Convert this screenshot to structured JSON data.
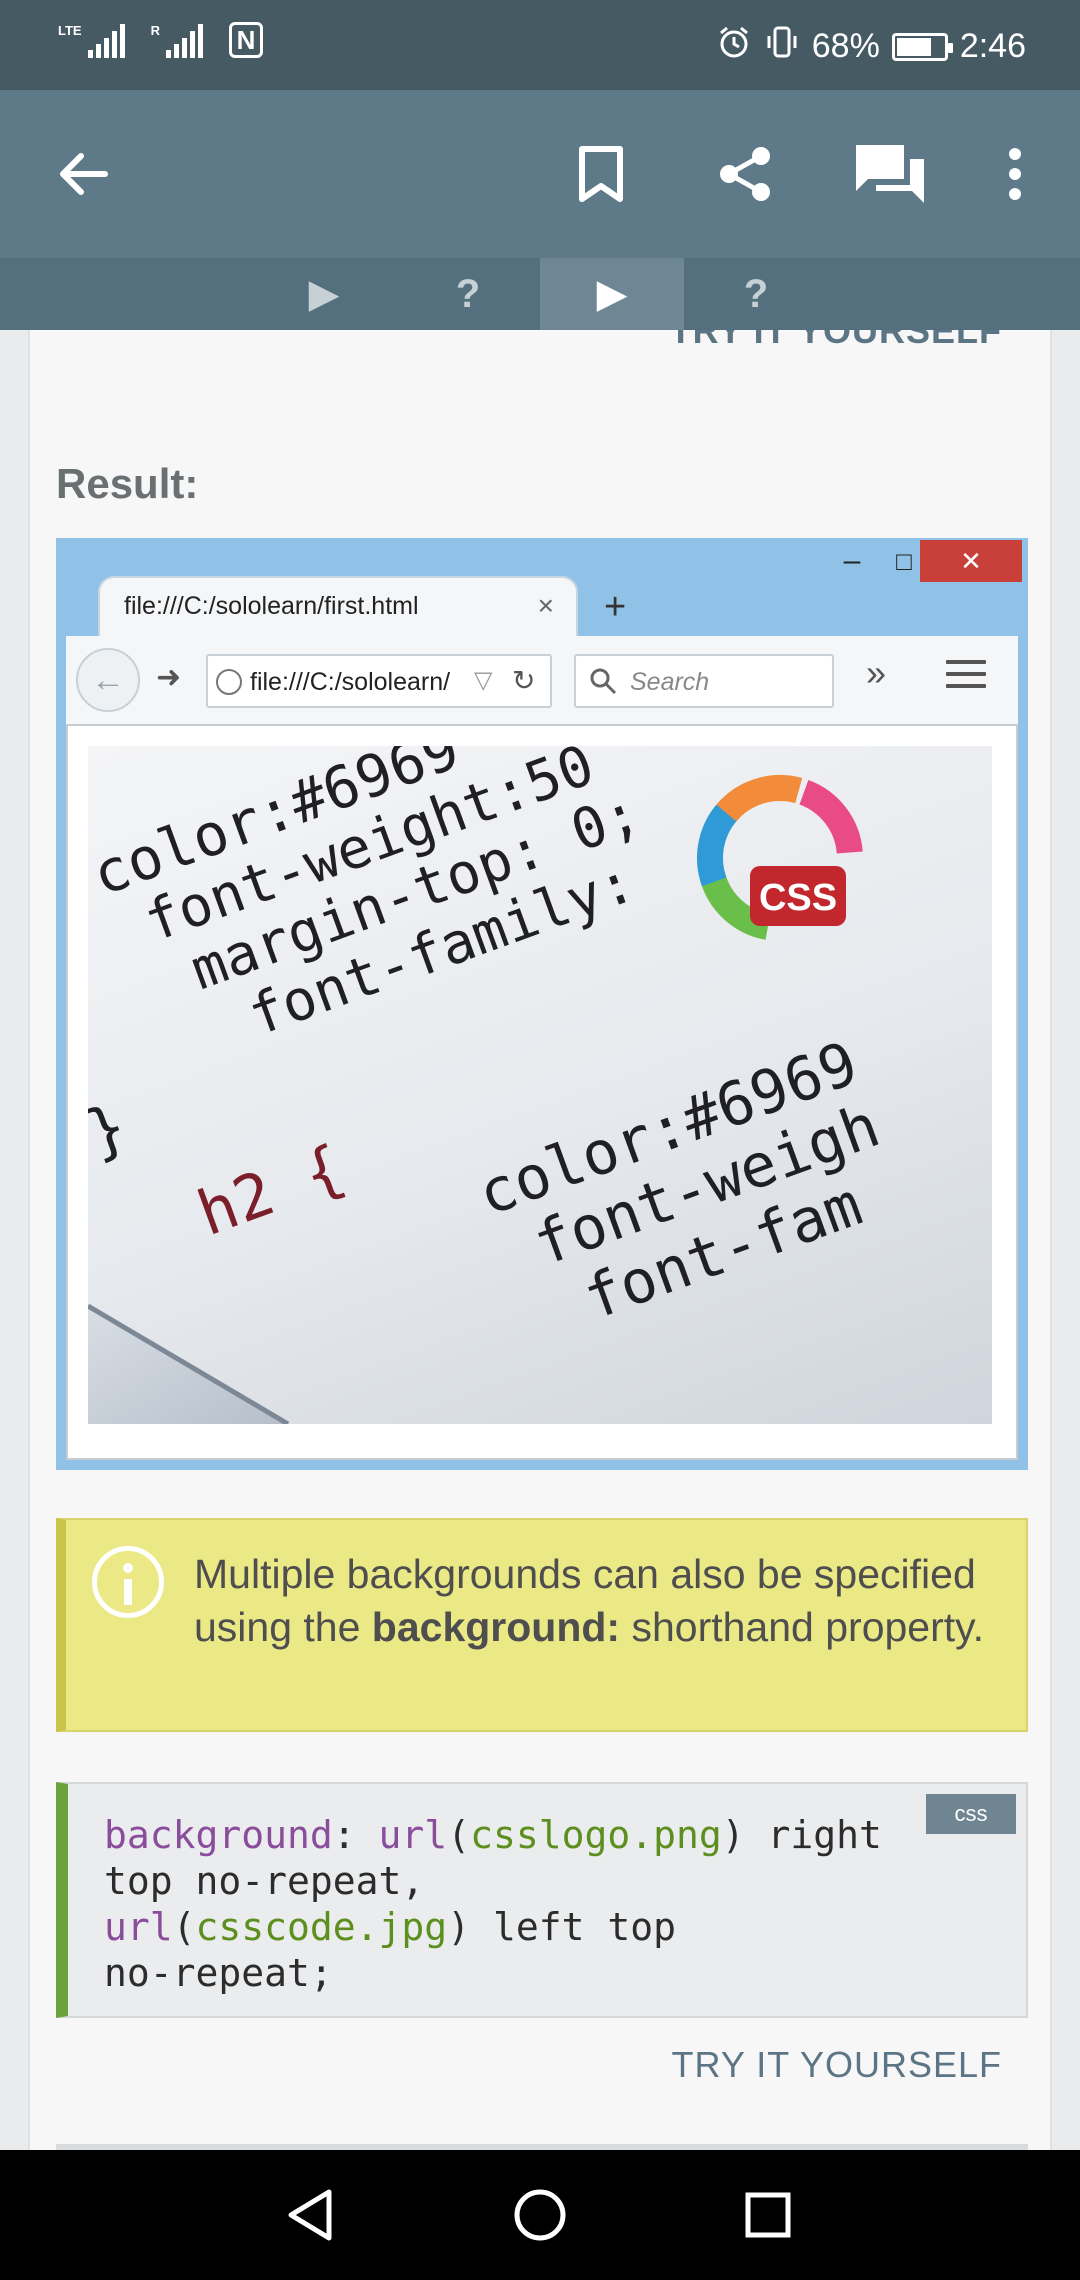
{
  "status_bar": {
    "network_left": "LTE",
    "network_right": "R",
    "battery": "68%",
    "time": "2:46"
  },
  "toolbar": {
    "icons": [
      "back-arrow-icon",
      "bookmark-icon",
      "share-icon",
      "comments-icon",
      "more-vert-icon"
    ]
  },
  "lesson_tabs": [
    {
      "symbol": "▶",
      "active": false
    },
    {
      "symbol": "?",
      "active": false
    },
    {
      "symbol": "▶",
      "active": true
    },
    {
      "symbol": "?",
      "active": false
    }
  ],
  "content": {
    "previous_try_label": "TRY IT YOURSELF",
    "result_label": "Result:",
    "browser": {
      "tab_title": "file:///C:/sololearn/first.html",
      "tab_close": "×",
      "new_tab": "+",
      "url": "file:///C:/sololearn/first.html",
      "search_placeholder": "Search",
      "more": "»",
      "window_buttons": [
        "–",
        "□",
        "✕"
      ],
      "photo_text": {
        "line1": "color:#6969",
        "line2": "font-weight:50",
        "line3": "margin-top: 0;",
        "line4": "font-family:",
        "line5": "}",
        "line6": "h2 {",
        "line7": "color:#6969",
        "line8": "font-weigh",
        "line9": "font-fam",
        "logo": "CSS"
      }
    },
    "note": {
      "text_before": "Multiple backgrounds can also be specified using the ",
      "bold": "background:",
      "text_after": " shorthand property."
    },
    "code": {
      "lang": "css",
      "line1_prop": "background",
      "line1_colon": ": ",
      "line1_fn": "url",
      "line1_open": "(",
      "line1_str": "csslogo.png",
      "line1_rest": ") right",
      "line2": "top no-repeat,",
      "line3_fn": "url",
      "line3_open": "(",
      "line3_str": "csscode.jpg",
      "line3_rest": ") left top",
      "line4": "no-repeat;"
    },
    "try_it_label": "TRY IT YOURSELF"
  },
  "system_nav": {
    "icons": [
      "back-triangle-icon",
      "home-circle-icon",
      "recents-square-icon"
    ]
  },
  "colors": {
    "status_bar": "#465a64",
    "toolbar": "#5e7a89",
    "accent_green": "#6aa33d",
    "note_bg": "#ebe886",
    "link": "#5b7585"
  }
}
